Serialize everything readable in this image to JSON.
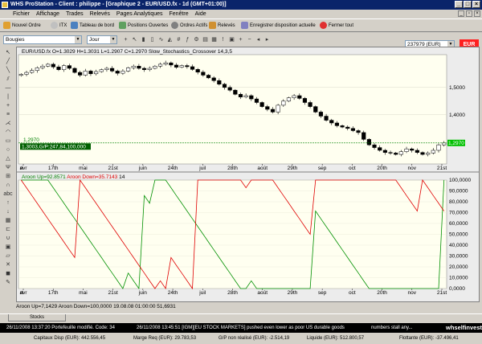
{
  "title": "WHS ProStation - Client : philippe - [Graphique 2 - EUR/USD.fx - 1d (GMT+01:00)]",
  "menu": [
    "Fichier",
    "Affichage",
    "Trades",
    "Relevés",
    "Pages Analytiques",
    "Fenêtre",
    "Aide"
  ],
  "toolbar": [
    "Nouvel Ordre",
    "ITX",
    "Tableau de bord",
    "Positions Ouvertes",
    "Ordres Actifs",
    "Relevés",
    "Enregistrer disposition actuelle",
    "Fermer tout"
  ],
  "account": "237979 (EUR)",
  "currency_badge": "EUR",
  "chart_style": "Bougies",
  "period": "Jour",
  "price_header": "EUR/USD.fx O=1.3029 H=1.3031 L=1.2907 C=1.2970   Slow_Stochastics_Crossover 14,3,5",
  "aroon_header_up": "Aroon Up=92.8571",
  "aroon_header_dn": "Aroon Down=35.7143",
  "aroon_header_period": "14",
  "info_line": "Aroon Up=7,1429 Aroon Down=100,0000   19.08.08 01:00:00 51,6931",
  "tab": "Stocks",
  "status": {
    "left": "26/11/2008 13:37:20 Portefeuille modifié. Code: 34",
    "news": "26/11/2008 13:45:51 [IGM][EU STOCK MARKETS] pushed even lower as poor US durable goods",
    "news2": "numbers stall any...",
    "logo": "whselfinvest"
  },
  "balances": [
    "Capitaux Disp (EUR): 442.556,45",
    "Marge Req (EUR): 29.783,53",
    "G/P non réalisé (EUR): -2.514,19",
    "Liquide (EUR): 512.800,57",
    "Flottante (EUR): -37.496,41"
  ],
  "price_box": "1,2970",
  "order_line": "1,3003,G/P:247,84,100,000",
  "chart_data": [
    {
      "type": "candlestick",
      "title": "EUR/USD.fx",
      "y_ticks": [
        "1,5000",
        "1,4000"
      ],
      "ylim": [
        1.22,
        1.62
      ],
      "x_labels": [
        "avr",
        "17th",
        "mai",
        "21st",
        "juin",
        "24th",
        "juil",
        "28th",
        "août",
        "29th",
        "sep",
        "oct",
        "20th",
        "nov",
        "21st"
      ],
      "close": [
        1.548,
        1.555,
        1.562,
        1.572,
        1.578,
        1.585,
        1.575,
        1.565,
        1.58,
        1.57,
        1.555,
        1.545,
        1.56,
        1.55,
        1.558,
        1.565,
        1.57,
        1.56,
        1.552,
        1.56,
        1.572,
        1.578,
        1.57,
        1.565,
        1.57,
        1.578,
        1.585,
        1.59,
        1.582,
        1.574,
        1.58,
        1.576,
        1.566,
        1.556,
        1.545,
        1.535,
        1.525,
        1.512,
        1.5,
        1.49,
        1.475,
        1.465,
        1.47,
        1.458,
        1.445,
        1.43,
        1.42,
        1.41,
        1.435,
        1.45,
        1.462,
        1.47,
        1.46,
        1.445,
        1.43,
        1.41,
        1.395,
        1.38,
        1.37,
        1.36,
        1.355,
        1.35,
        1.342,
        1.335,
        1.31,
        1.29,
        1.28,
        1.27,
        1.262,
        1.26,
        1.255,
        1.265,
        1.275,
        1.27,
        1.262,
        1.255,
        1.26,
        1.27,
        1.29,
        1.297
      ]
    },
    {
      "type": "line",
      "title": "Aroon",
      "series": [
        {
          "name": "Aroon Up"
        },
        {
          "name": "Aroon Down"
        }
      ],
      "y_ticks": [
        "100,0000",
        "90,0000",
        "80,0000",
        "70,0000",
        "60,0000",
        "50,0000",
        "40,0000",
        "30,0000",
        "20,0000",
        "10,0000",
        "0,0000"
      ],
      "ylim": [
        0,
        100
      ]
    }
  ]
}
